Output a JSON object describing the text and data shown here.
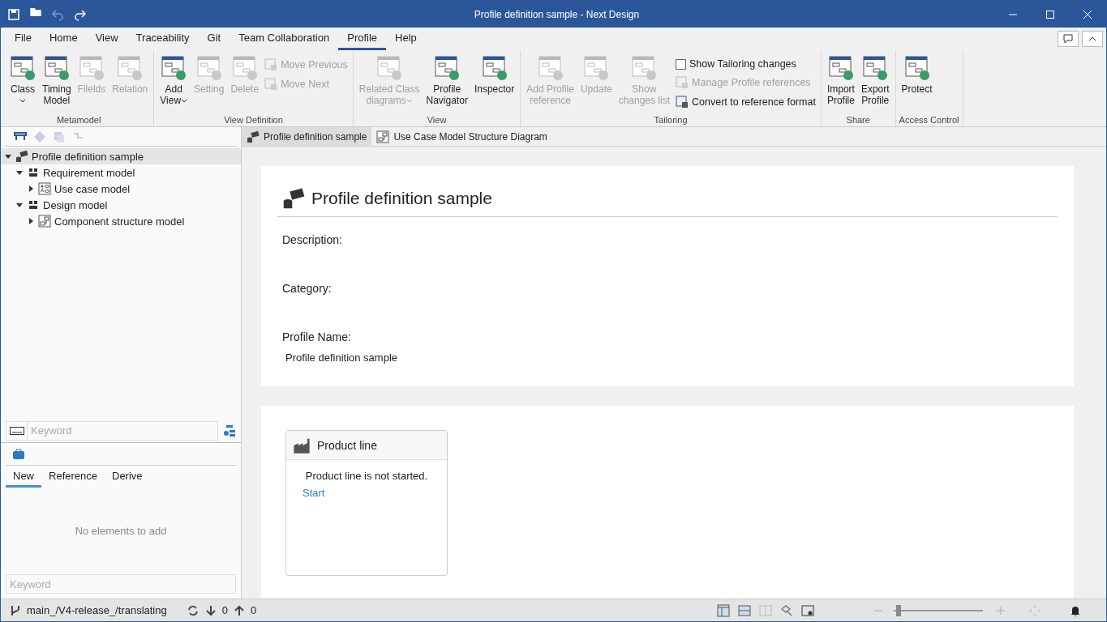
{
  "window": {
    "title": "Profile definition sample - Next Design"
  },
  "menu_tabs": [
    {
      "label": "File",
      "selected": false
    },
    {
      "label": "Home",
      "selected": false
    },
    {
      "label": "View",
      "selected": false
    },
    {
      "label": "Traceability",
      "selected": false
    },
    {
      "label": "Git",
      "selected": false
    },
    {
      "label": "Team Collaboration",
      "selected": false
    },
    {
      "label": "Profile",
      "selected": true
    },
    {
      "label": "Help",
      "selected": false
    }
  ],
  "ribbon": {
    "groups": [
      {
        "label": "Metamodel",
        "items": [
          {
            "kind": "large",
            "lines": [
              "Class"
            ],
            "dropdown": true,
            "disabled": false
          },
          {
            "kind": "large",
            "lines": [
              "Timing",
              "Model"
            ],
            "disabled": false
          },
          {
            "kind": "large",
            "lines": [
              "Filelds"
            ],
            "disabled": true
          },
          {
            "kind": "large",
            "lines": [
              "Relation"
            ],
            "disabled": true
          }
        ]
      },
      {
        "label": "View Definition",
        "items": [
          {
            "kind": "large",
            "lines": [
              "Add",
              "View"
            ],
            "dropdown": true,
            "disabled": false
          },
          {
            "kind": "large",
            "lines": [
              "Setting"
            ],
            "disabled": true
          },
          {
            "kind": "large",
            "lines": [
              "Delete"
            ],
            "disabled": true
          },
          {
            "kind": "small",
            "label": "Move Previous",
            "disabled": true
          },
          {
            "kind": "small",
            "label": "Move Next",
            "disabled": true
          }
        ]
      },
      {
        "label": "View",
        "items": [
          {
            "kind": "large",
            "lines": [
              "Related Class",
              "diagrams"
            ],
            "dropdown": true,
            "disabled": true
          },
          {
            "kind": "large",
            "lines": [
              "Profile",
              "Navigator"
            ],
            "disabled": false
          },
          {
            "kind": "large",
            "lines": [
              "Inspector"
            ],
            "disabled": false
          }
        ]
      },
      {
        "label": "Tailoring",
        "items": [
          {
            "kind": "large",
            "lines": [
              "Add Profile",
              "reference"
            ],
            "disabled": true
          },
          {
            "kind": "large",
            "lines": [
              "Update"
            ],
            "disabled": true
          },
          {
            "kind": "large",
            "lines": [
              "Show",
              "changes list"
            ],
            "disabled": true
          },
          {
            "kind": "check",
            "label": "Show Tailoring changes",
            "checked": false
          },
          {
            "kind": "small",
            "label": "Manage Profile references",
            "disabled": true
          },
          {
            "kind": "small",
            "label": "Convert to reference format",
            "disabled": false
          }
        ]
      },
      {
        "label": "Share",
        "items": [
          {
            "kind": "large",
            "lines": [
              "Import",
              "Profile"
            ],
            "disabled": false
          },
          {
            "kind": "large",
            "lines": [
              "Export",
              "Profile"
            ],
            "disabled": false
          }
        ]
      },
      {
        "label": "Access Control",
        "items": [
          {
            "kind": "large",
            "lines": [
              "Protect"
            ],
            "disabled": false
          }
        ]
      }
    ]
  },
  "tree": [
    {
      "label": "Profile definition sample",
      "kind": "profile",
      "expanded": true,
      "selected": true,
      "children": [
        {
          "label": "Requirement model",
          "kind": "package",
          "expanded": true,
          "selected": false,
          "children": [
            {
              "label": "Use case model",
              "kind": "usecase",
              "expanded": false,
              "selected": false
            }
          ]
        },
        {
          "label": "Design model",
          "kind": "package",
          "expanded": true,
          "selected": false,
          "children": [
            {
              "label": "Component structure model",
              "kind": "component",
              "expanded": false,
              "selected": false
            }
          ]
        }
      ]
    }
  ],
  "tree_search": {
    "placeholder": "Keyword"
  },
  "toolbox": {
    "tabs": [
      {
        "label": "New",
        "selected": true
      },
      {
        "label": "Reference",
        "selected": false
      },
      {
        "label": "Derive",
        "selected": false
      }
    ],
    "empty_message": "No elements to add",
    "search": {
      "placeholder": "Keyword"
    }
  },
  "document_tabs": [
    {
      "label": "Profile definition sample",
      "selected": true
    },
    {
      "label": "Use Case Model Structure Diagram",
      "selected": false
    }
  ],
  "profile_card": {
    "title": "Profile definition sample",
    "fields": [
      {
        "label": "Description:"
      },
      {
        "label": "Category:"
      },
      {
        "label": "Profile Name:",
        "value": "Profile definition sample"
      }
    ]
  },
  "product_line": {
    "title": "Product line",
    "message": "Product line is not started.",
    "link": "Start"
  },
  "status_bar": {
    "branch": "main_/V4-release_/translating",
    "incoming": "0",
    "outgoing": "0",
    "zoom": {
      "level": 0.05
    }
  }
}
